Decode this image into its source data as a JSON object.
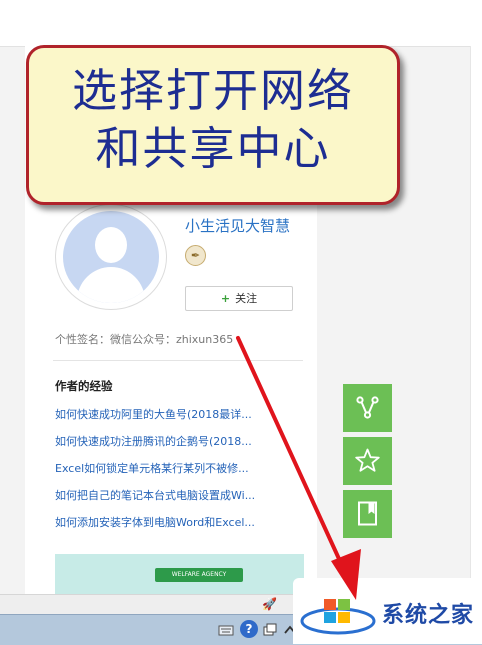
{
  "callout": {
    "line1": "选择打开网络",
    "line2": "和共享中心"
  },
  "profile": {
    "username": "小生活见大智慧",
    "follow_label": "关注",
    "signature": "个性签名：微信公众号：zhixun365"
  },
  "experience": {
    "title": "作者的经验",
    "items": [
      "如何快速成功阿里的大鱼号(2018最详...",
      "如何快速成功注册腾讯的企鹅号(2018...",
      "Excel如何锁定单元格某行某列不被修...",
      "如何把自己的笔记本台式电脑设置成Wi...",
      "如何添加安装字体到电脑Word和Excel..."
    ]
  },
  "thumbnail": {
    "banner_text": "WELFARE AGENCY"
  },
  "side_buttons": [
    "share-icon",
    "star-icon",
    "bookmark-icon"
  ],
  "watermark": {
    "text": "系统之家"
  },
  "colors": {
    "callout_bg": "#fbf7c9",
    "callout_border": "#b0232a",
    "callout_text": "#1d2d92",
    "link": "#2563b8",
    "side_button": "#6cbf55",
    "arrow": "#e0141c"
  }
}
